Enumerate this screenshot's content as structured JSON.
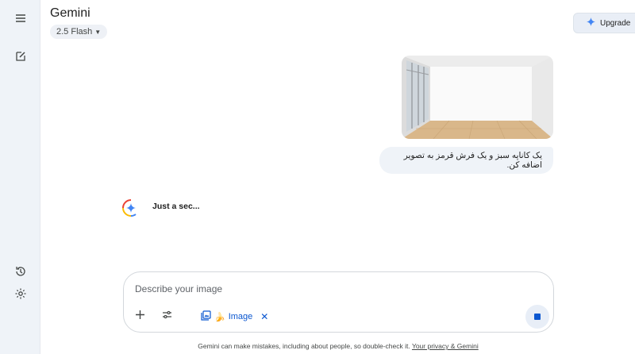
{
  "app": {
    "title": "Gemini",
    "model_label": "2.5 Flash"
  },
  "header": {
    "upgrade_label": "Upgrade"
  },
  "sidebar": {
    "items": [
      {
        "icon": "menu-icon"
      },
      {
        "icon": "new-chat-icon"
      },
      {
        "icon": "activity-icon"
      },
      {
        "icon": "settings-icon"
      }
    ]
  },
  "conversation": {
    "user_message": "یک کاناپه سبز و یک فرش قرمز به تصویر اضافه کن.",
    "status_text": "Just a sec..."
  },
  "composer": {
    "placeholder": "Describe your image",
    "tool_chip_label": "Image"
  },
  "footer": {
    "disclaimer": "Gemini can make mistakes, including about people, so double-check it.",
    "privacy_link": "Your privacy & Gemini"
  },
  "colors": {
    "accent": "#0b57d0",
    "sidebar_bg": "#eff3f8"
  }
}
